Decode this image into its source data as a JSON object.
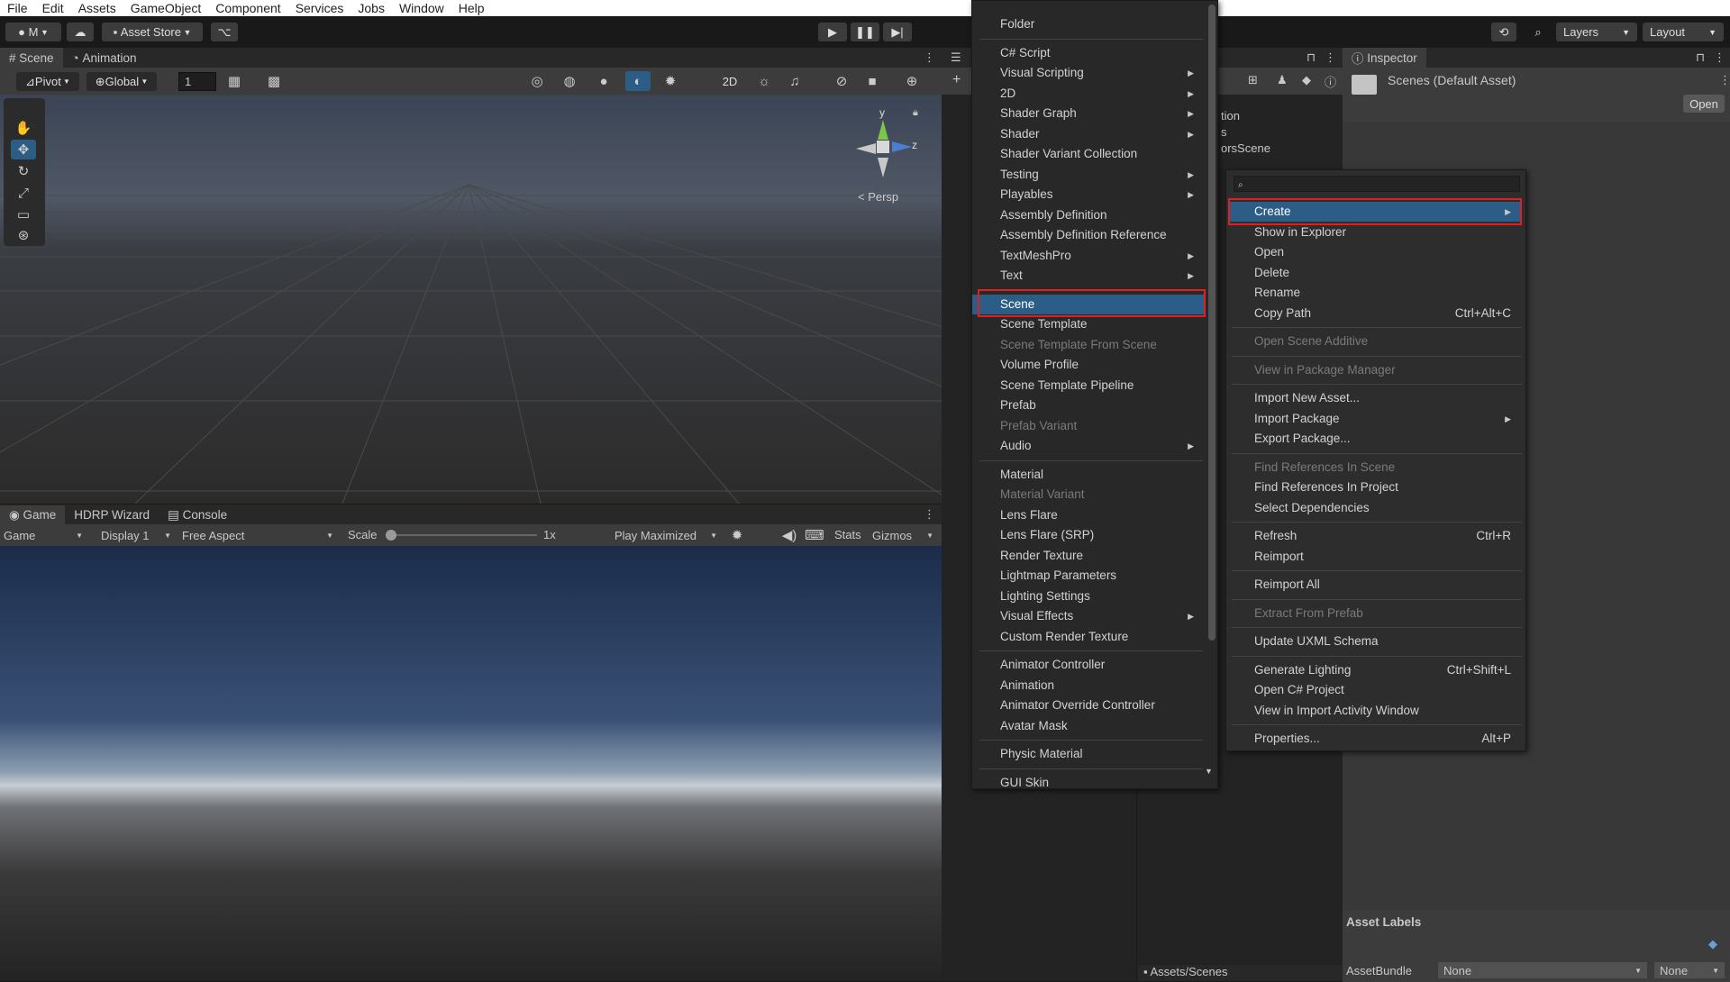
{
  "menubar": {
    "items": [
      "File",
      "Edit",
      "Assets",
      "GameObject",
      "Component",
      "Services",
      "Jobs",
      "Window",
      "Help"
    ]
  },
  "toolbar": {
    "account": "M",
    "asset_store": "Asset Store",
    "layers": "Layers",
    "layout": "Layout"
  },
  "scene_panel": {
    "tab_scene": "Scene",
    "tab_animation": "Animation",
    "pivot": "Pivot",
    "global": "Global",
    "grid_value": "1",
    "mode_2d": "2D",
    "persp": "< Persp",
    "axis_y": "y",
    "axis_z": "z"
  },
  "game_panel": {
    "tab_game": "Game",
    "tab_hdrp": "HDRP Wizard",
    "tab_console": "Console",
    "game_select": "Game",
    "display": "Display 1",
    "aspect": "Free Aspect",
    "scale_label": "Scale",
    "scale_value": "1x",
    "play_mode": "Play Maximized",
    "stats": "Stats",
    "gizmos": "Gizmos",
    "scale_slider_value": 0.0
  },
  "hierarchy_fragments": {
    "line1": "tion",
    "line2": "s",
    "line3": "orsScene"
  },
  "inspector": {
    "tab": "Inspector",
    "title": "Scenes (Default Asset)",
    "open_button": "Open",
    "asset_labels": "Asset Labels",
    "assetbundle_label": "AssetBundle",
    "assetbundle_value": "None",
    "assetbundle_variant": "None"
  },
  "project": {
    "path": "Assets/Scenes"
  },
  "create_menu": {
    "items": [
      {
        "label": "Folder",
        "sub": false,
        "disabled": false
      },
      {
        "sep": true
      },
      {
        "label": "C# Script",
        "sub": false,
        "disabled": false
      },
      {
        "label": "Visual Scripting",
        "sub": true,
        "disabled": false
      },
      {
        "label": "2D",
        "sub": true,
        "disabled": false
      },
      {
        "label": "Shader Graph",
        "sub": true,
        "disabled": false
      },
      {
        "label": "Shader",
        "sub": true,
        "disabled": false
      },
      {
        "label": "Shader Variant Collection",
        "sub": false,
        "disabled": false
      },
      {
        "label": "Testing",
        "sub": true,
        "disabled": false
      },
      {
        "label": "Playables",
        "sub": true,
        "disabled": false
      },
      {
        "label": "Assembly Definition",
        "sub": false,
        "disabled": false
      },
      {
        "label": "Assembly Definition Reference",
        "sub": false,
        "disabled": false
      },
      {
        "label": "TextMeshPro",
        "sub": true,
        "disabled": false
      },
      {
        "label": "Text",
        "sub": true,
        "disabled": false
      },
      {
        "sep": true
      },
      {
        "label": "Scene",
        "sub": false,
        "disabled": false,
        "selected": true
      },
      {
        "label": "Scene Template",
        "sub": false,
        "disabled": false
      },
      {
        "label": "Scene Template From Scene",
        "sub": false,
        "disabled": true
      },
      {
        "label": "Volume Profile",
        "sub": false,
        "disabled": false
      },
      {
        "label": "Scene Template Pipeline",
        "sub": false,
        "disabled": false
      },
      {
        "label": "Prefab",
        "sub": false,
        "disabled": false
      },
      {
        "label": "Prefab Variant",
        "sub": false,
        "disabled": true
      },
      {
        "label": "Audio",
        "sub": true,
        "disabled": false
      },
      {
        "sep": true
      },
      {
        "label": "Material",
        "sub": false,
        "disabled": false
      },
      {
        "label": "Material Variant",
        "sub": false,
        "disabled": true
      },
      {
        "label": "Lens Flare",
        "sub": false,
        "disabled": false
      },
      {
        "label": "Lens Flare (SRP)",
        "sub": false,
        "disabled": false
      },
      {
        "label": "Render Texture",
        "sub": false,
        "disabled": false
      },
      {
        "label": "Lightmap Parameters",
        "sub": false,
        "disabled": false
      },
      {
        "label": "Lighting Settings",
        "sub": false,
        "disabled": false
      },
      {
        "label": "Visual Effects",
        "sub": true,
        "disabled": false
      },
      {
        "label": "Custom Render Texture",
        "sub": false,
        "disabled": false
      },
      {
        "sep": true
      },
      {
        "label": "Animator Controller",
        "sub": false,
        "disabled": false
      },
      {
        "label": "Animation",
        "sub": false,
        "disabled": false
      },
      {
        "label": "Animator Override Controller",
        "sub": false,
        "disabled": false
      },
      {
        "label": "Avatar Mask",
        "sub": false,
        "disabled": false
      },
      {
        "sep": true
      },
      {
        "label": "Physic Material",
        "sub": false,
        "disabled": false
      },
      {
        "sep": true
      },
      {
        "label": "GUI Skin",
        "sub": false,
        "disabled": false
      }
    ]
  },
  "context_menu": {
    "items": [
      {
        "label": "Create",
        "sub": true,
        "disabled": false,
        "selected": true
      },
      {
        "label": "Show in Explorer",
        "disabled": false
      },
      {
        "label": "Open",
        "disabled": false
      },
      {
        "label": "Delete",
        "disabled": false
      },
      {
        "label": "Rename",
        "disabled": false
      },
      {
        "label": "Copy Path",
        "shortcut": "Ctrl+Alt+C",
        "disabled": false
      },
      {
        "sep": true
      },
      {
        "label": "Open Scene Additive",
        "disabled": true
      },
      {
        "sep": true
      },
      {
        "label": "View in Package Manager",
        "disabled": true
      },
      {
        "sep": true
      },
      {
        "label": "Import New Asset...",
        "disabled": false
      },
      {
        "label": "Import Package",
        "sub": true,
        "disabled": false
      },
      {
        "label": "Export Package...",
        "disabled": false
      },
      {
        "sep": true
      },
      {
        "label": "Find References In Scene",
        "disabled": true
      },
      {
        "label": "Find References In Project",
        "disabled": false
      },
      {
        "label": "Select Dependencies",
        "disabled": false
      },
      {
        "sep": true
      },
      {
        "label": "Refresh",
        "shortcut": "Ctrl+R",
        "disabled": false
      },
      {
        "label": "Reimport",
        "disabled": false
      },
      {
        "sep": true
      },
      {
        "label": "Reimport All",
        "disabled": false
      },
      {
        "sep": true
      },
      {
        "label": "Extract From Prefab",
        "disabled": true
      },
      {
        "sep": true
      },
      {
        "label": "Update UXML Schema",
        "disabled": false
      },
      {
        "sep": true
      },
      {
        "label": "Generate Lighting",
        "shortcut": "Ctrl+Shift+L",
        "disabled": false
      },
      {
        "label": "Open C# Project",
        "disabled": false
      },
      {
        "label": "View in Import Activity Window",
        "disabled": false
      },
      {
        "sep": true
      },
      {
        "label": "Properties...",
        "shortcut": "Alt+P",
        "disabled": false
      }
    ]
  },
  "colors": {
    "highlight": "#2c5d87",
    "red_outline": "#e02020",
    "panel": "#282828",
    "bar": "#3c3c3c"
  }
}
